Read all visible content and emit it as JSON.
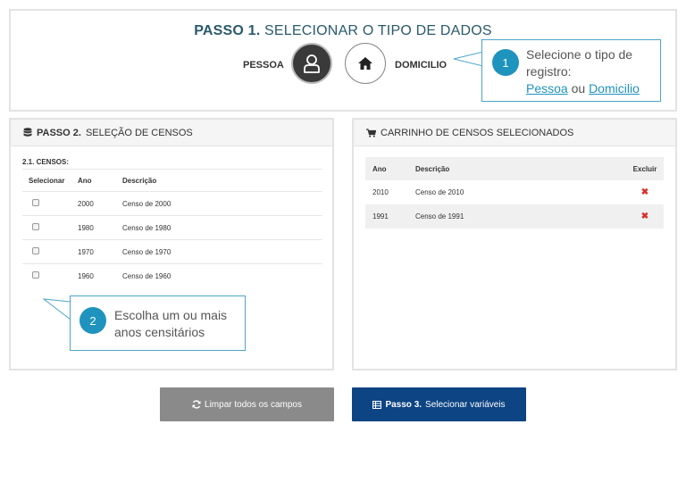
{
  "step1": {
    "title_bold": "PASSO 1.",
    "title_rest": " SELECIONAR O TIPO DE DADOS",
    "option_pessoa": "PESSOA",
    "option_domicilio": "DOMICILIO",
    "selected": "PESSOA"
  },
  "callout1": {
    "number": "1",
    "line1": "Selecione o tipo de",
    "line2": "registro:",
    "link_pessoa": "Pessoa",
    "conjunction": " ou ",
    "link_domicilio": "Domicilio"
  },
  "step2": {
    "title_bold": "PASSO 2.",
    "title_rest": "SELEÇÃO DE CENSOS",
    "sub_label": "2.1. CENSOS:",
    "columns": [
      "Selecionar",
      "Ano",
      "Descrição"
    ],
    "rows": [
      {
        "year": "2000",
        "desc": "Censo de 2000",
        "checked": false
      },
      {
        "year": "1980",
        "desc": "Censo de 1980",
        "checked": false
      },
      {
        "year": "1970",
        "desc": "Censo de 1970",
        "checked": false
      },
      {
        "year": "1960",
        "desc": "Censo de 1960",
        "checked": false
      }
    ]
  },
  "callout2": {
    "number": "2",
    "line1": "Escolha um ou mais",
    "line2": "anos censitários"
  },
  "cart": {
    "title": "CARRINHO DE CENSOS SELECIONADOS",
    "columns": [
      "Ano",
      "Descrição",
      "Excluir"
    ],
    "rows": [
      {
        "year": "2010",
        "desc": "Censo de 2010",
        "delete_icon": "✖"
      },
      {
        "year": "1991",
        "desc": "Censo de 1991",
        "delete_icon": "✖"
      }
    ]
  },
  "buttons": {
    "clear_label": "Limpar todos os campos",
    "next_bold": "Passo 3.",
    "next_rest": "Selecionar variáveis"
  },
  "colors": {
    "title": "#2a5a6b",
    "accent": "#1e93bd",
    "primary_button": "#0d4483",
    "secondary_button": "#8a8a8a",
    "delete": "#d9302c"
  }
}
